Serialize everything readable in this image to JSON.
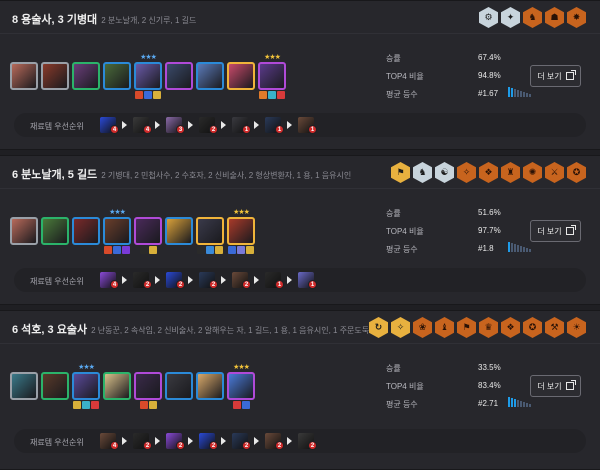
{
  "stats_labels": {
    "win": "승률",
    "top4": "TOP4 비율",
    "avg": "평균 등수"
  },
  "more_label": "더 보기",
  "priority_label": "재료템 우선순위",
  "comps": [
    {
      "title": "8 용술사, 3 기병대",
      "sub": "2 분노날개, 2 신기루, 1 길드",
      "traits": [
        {
          "tier": "silver",
          "glyph": "⚙"
        },
        {
          "tier": "silver",
          "glyph": "✦"
        },
        {
          "tier": "bronze",
          "glyph": "♞"
        },
        {
          "tier": "bronze",
          "glyph": "☗"
        },
        {
          "tier": "bronze",
          "glyph": "✸"
        }
      ],
      "units": [
        {
          "stars": "",
          "cost": 1,
          "color": "#b86a5a",
          "items": []
        },
        {
          "stars": "",
          "cost": 1,
          "color": "#8a3a2a",
          "items": []
        },
        {
          "stars": "",
          "cost": 2,
          "color": "#6a3e7a",
          "items": []
        },
        {
          "stars": "",
          "cost": 3,
          "color": "#4a6a3a",
          "items": []
        },
        {
          "stars": "★★★",
          "starcol": "s2",
          "cost": 3,
          "color": "#6a5aa8",
          "items": [
            "#d84a2a",
            "#3a6ad8",
            "#d8b03a"
          ]
        },
        {
          "stars": "",
          "cost": 4,
          "color": "#3a4a6a",
          "items": []
        },
        {
          "stars": "",
          "cost": 3,
          "color": "#5a7ab8",
          "items": []
        },
        {
          "stars": "",
          "cost": 5,
          "color": "#c84a6a",
          "items": []
        },
        {
          "stars": "★★★",
          "starcol": "s3",
          "cost": 4,
          "color": "#5a3a8a",
          "items": [
            "#e07a2a",
            "#3ab0c8",
            "#d83a3a"
          ]
        }
      ],
      "win": "67.4%",
      "top4": "94.8%",
      "avg": "#1.67",
      "bars": 2,
      "priority": [
        {
          "color": "#2a4ad8",
          "n": "4"
        },
        {
          "color": "#3a3a3a",
          "n": "4"
        },
        {
          "color": "#8a6aa8",
          "n": "3"
        },
        {
          "color": "#2a2a2a",
          "n": "2"
        },
        {
          "color": "#3a3a40",
          "n": "1"
        },
        {
          "color": "#2a3a5a",
          "n": "1"
        },
        {
          "color": "#6a4a3a",
          "n": "1"
        }
      ]
    },
    {
      "title": "6 분노날개, 5 길드",
      "sub": "2 기병대, 2 민첩사수, 2 수호자, 2 신비술사, 2 형상변환자, 1 용, 1 음유시인",
      "traits": [
        {
          "tier": "gold",
          "glyph": "⚑"
        },
        {
          "tier": "silver",
          "glyph": "♞"
        },
        {
          "tier": "silver",
          "glyph": "☯"
        },
        {
          "tier": "bronze",
          "glyph": "✧"
        },
        {
          "tier": "bronze",
          "glyph": "❖"
        },
        {
          "tier": "bronze",
          "glyph": "♜"
        },
        {
          "tier": "bronze",
          "glyph": "✺"
        },
        {
          "tier": "bronze",
          "glyph": "⚔"
        },
        {
          "tier": "bronze",
          "glyph": "✪"
        }
      ],
      "units": [
        {
          "stars": "",
          "cost": 1,
          "color": "#b86a5a",
          "items": []
        },
        {
          "stars": "",
          "cost": 2,
          "color": "#4a7a3a",
          "items": []
        },
        {
          "stars": "",
          "cost": 3,
          "color": "#7a2a2a",
          "items": []
        },
        {
          "stars": "★★★",
          "starcol": "s2",
          "cost": 3,
          "color": "#6a3e2a",
          "items": [
            "#d84a2a",
            "#3a6ad8",
            "#7a3ad8"
          ]
        },
        {
          "stars": "",
          "cost": 4,
          "color": "#4a2a5a",
          "items": [
            "#2a2a2a",
            "#d8b03a"
          ]
        },
        {
          "stars": "",
          "cost": 3,
          "color": "#d8a03a",
          "items": []
        },
        {
          "stars": "",
          "cost": 5,
          "color": "#3a3a4a",
          "items": [
            "#2a2a2a",
            "#3a8ad8",
            "#d8b03a"
          ]
        },
        {
          "stars": "★★★",
          "starcol": "s3",
          "cost": 5,
          "color": "#a83a2a",
          "items": [
            "#3a6ad8",
            "#7a7ad8",
            "#d8b03a"
          ]
        }
      ],
      "win": "51.6%",
      "top4": "97.7%",
      "avg": "#1.8",
      "bars": 1,
      "priority": [
        {
          "color": "#8a4ad8",
          "n": "4"
        },
        {
          "color": "#2a2a2a",
          "n": "2"
        },
        {
          "color": "#2a4ad8",
          "n": "2"
        },
        {
          "color": "#2a3a5a",
          "n": "2"
        },
        {
          "color": "#6a4a3a",
          "n": "2"
        },
        {
          "color": "#2a2a2a",
          "n": "1"
        },
        {
          "color": "#6a6ac8",
          "n": "1"
        }
      ]
    },
    {
      "title": "6 석호, 3 요술사",
      "sub": "2 난동꾼, 2 속삭임, 2 신비술사, 2 알해우는 자, 1 길드, 1 용, 1 음유시인, 1 주문도둑",
      "traits": [
        {
          "tier": "gold",
          "glyph": "↻"
        },
        {
          "tier": "gold",
          "glyph": "✧"
        },
        {
          "tier": "bronze",
          "glyph": "❀"
        },
        {
          "tier": "bronze",
          "glyph": "♝"
        },
        {
          "tier": "bronze",
          "glyph": "⚑"
        },
        {
          "tier": "bronze",
          "glyph": "♛"
        },
        {
          "tier": "bronze",
          "glyph": "❖"
        },
        {
          "tier": "bronze",
          "glyph": "✪"
        },
        {
          "tier": "bronze",
          "glyph": "⚒"
        },
        {
          "tier": "bronze",
          "glyph": "☀"
        }
      ],
      "units": [
        {
          "stars": "",
          "cost": 1,
          "color": "#3a7a8a",
          "items": []
        },
        {
          "stars": "",
          "cost": 2,
          "color": "#5a3a2a",
          "items": []
        },
        {
          "stars": "★★★",
          "starcol": "s2",
          "cost": 3,
          "color": "#5a4a9a",
          "items": [
            "#d8b03a",
            "#3ab0c8",
            "#d83a3a"
          ]
        },
        {
          "stars": "",
          "cost": 2,
          "color": "#d8c08a",
          "items": []
        },
        {
          "stars": "",
          "cost": 4,
          "color": "#3a2a4a",
          "items": [
            "#d84a2a",
            "#d8b03a"
          ]
        },
        {
          "stars": "",
          "cost": 3,
          "color": "#3a3a40",
          "items": []
        },
        {
          "stars": "",
          "cost": 3,
          "color": "#d8a86a",
          "items": []
        },
        {
          "stars": "★★★",
          "starcol": "s3",
          "cost": 4,
          "color": "#4a7ad8",
          "items": [
            "#d83a3a",
            "#3a6ad8"
          ]
        }
      ],
      "win": "33.5%",
      "top4": "83.4%",
      "avg": "#2.71",
      "bars": 3,
      "priority": [
        {
          "color": "#6a4a3a",
          "n": "4"
        },
        {
          "color": "#2a2a2a",
          "n": "2"
        },
        {
          "color": "#8a4ad8",
          "n": "2"
        },
        {
          "color": "#2a4ad8",
          "n": "2"
        },
        {
          "color": "#2a3a5a",
          "n": "2"
        },
        {
          "color": "#6a4a3a",
          "n": "2"
        },
        {
          "color": "#3a3a3a",
          "n": "2"
        }
      ]
    }
  ]
}
